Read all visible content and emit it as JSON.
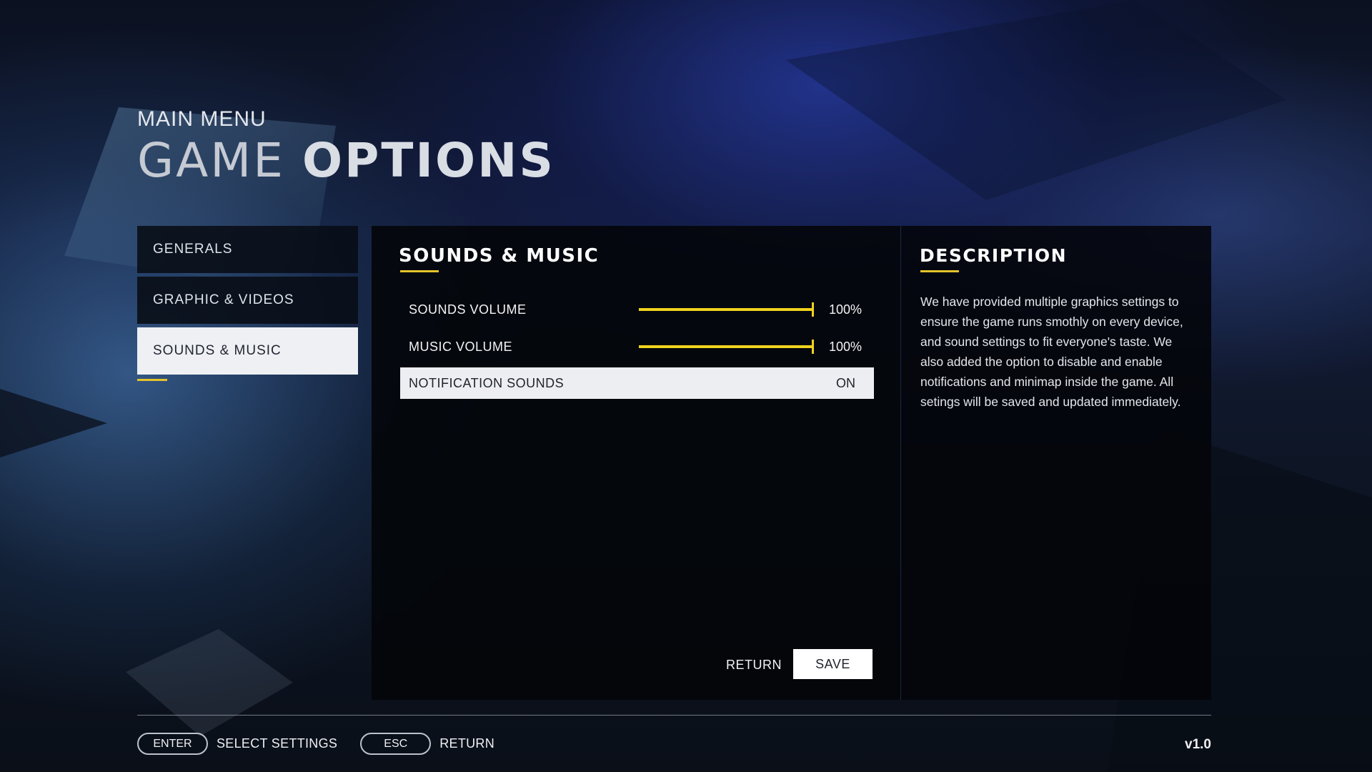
{
  "header": {
    "subtitle": "MAIN MENU",
    "title_light": "GAME",
    "title_bold": "OPTIONS"
  },
  "tabs": [
    {
      "label": "GENERALS",
      "active": false
    },
    {
      "label": "GRAPHIC & VIDEOS",
      "active": false
    },
    {
      "label": "SOUNDS & MUSIC",
      "active": true
    }
  ],
  "panel": {
    "title": "SOUNDS & MUSIC",
    "settings": [
      {
        "label": "SOUNDS VOLUME",
        "value": "100%",
        "level": 1.0
      },
      {
        "label": "MUSIC VOLUME",
        "value": "100%",
        "level": 1.0
      },
      {
        "label": "NOTIFICATION SOUNDS",
        "value": "ON",
        "selected": true
      }
    ],
    "return_label": "RETURN",
    "save_label": "SAVE"
  },
  "description": {
    "title": "DESCRIPTION",
    "text": "We have provided multiple graphics settings to ensure the game runs smothly on every device, and sound settings to fit everyone's taste. We also added the option to disable and enable notifications and minimap inside the game. All setings will be saved and updated immediately."
  },
  "footer": {
    "keys": [
      {
        "key": "ENTER",
        "action": "SELECT SETTINGS"
      },
      {
        "key": "ESC",
        "action": "RETURN"
      }
    ],
    "version": "v1.0"
  },
  "colors": {
    "accent": "#e5c32b",
    "slider": "#f0d21e",
    "active_tab_bg": "#eef0f3",
    "panel_bg": "#03050a"
  }
}
